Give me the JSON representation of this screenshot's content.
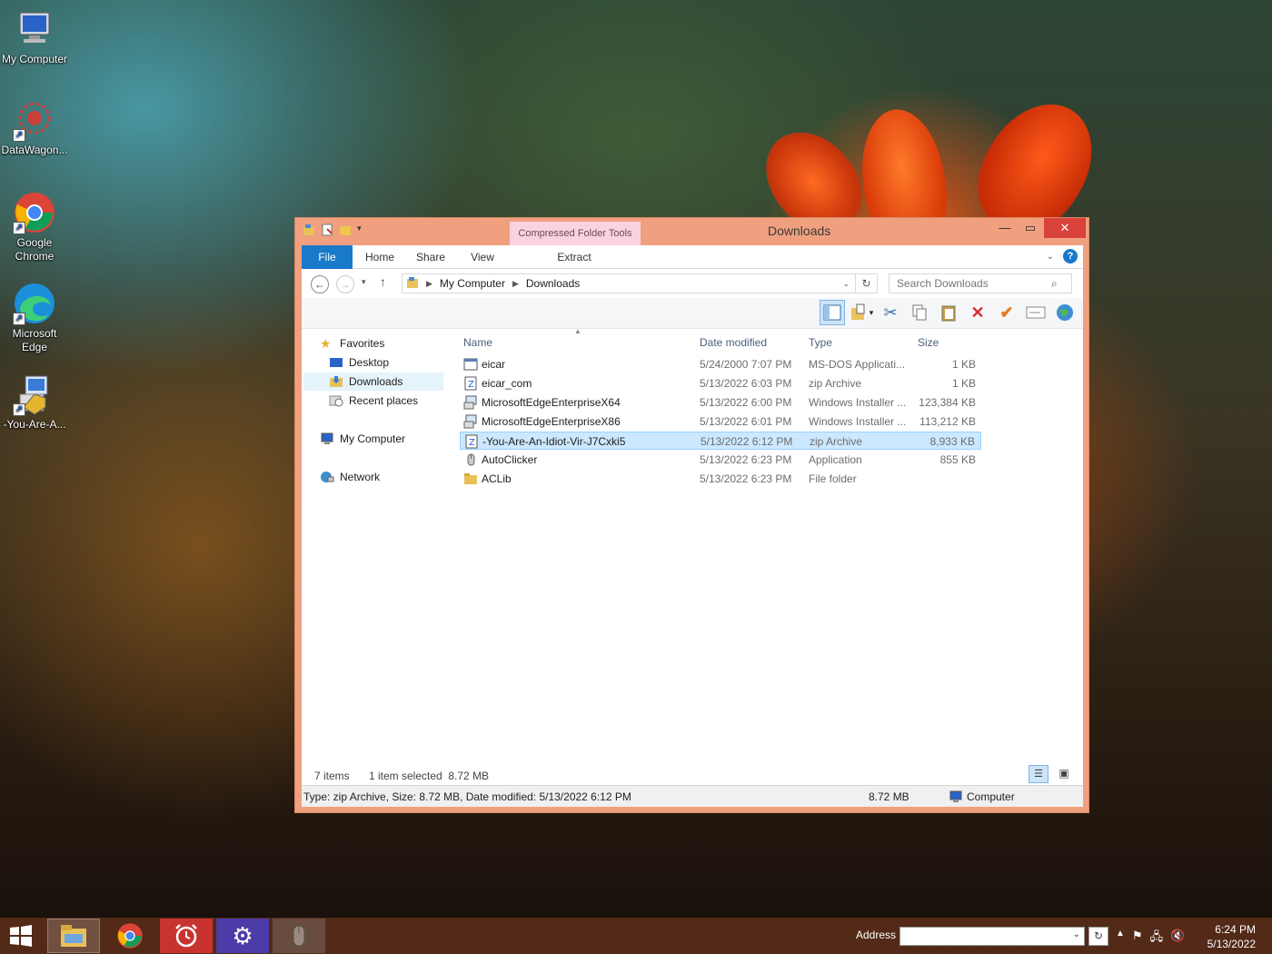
{
  "desktop": {
    "icons": [
      {
        "label": "My Computer",
        "icon": "monitor-icon"
      },
      {
        "label": "DataWagon...",
        "icon": "datawagon-icon"
      },
      {
        "label": "Google Chrome",
        "icon": "chrome-icon"
      },
      {
        "label": "Microsoft Edge",
        "icon": "edge-icon"
      },
      {
        "label": "-You-Are-A...",
        "icon": "installer-icon"
      }
    ]
  },
  "window": {
    "title": "Downloads",
    "context_tab": "Compressed Folder Tools",
    "ribbon_tabs": {
      "file": "File",
      "home": "Home",
      "share": "Share",
      "view": "View",
      "extract": "Extract"
    },
    "address": {
      "root": "My Computer",
      "current": "Downloads"
    },
    "search_placeholder": "Search Downloads",
    "nav": {
      "favorites": "Favorites",
      "desktop": "Desktop",
      "downloads": "Downloads",
      "recent": "Recent places",
      "computer": "My Computer",
      "network": "Network"
    },
    "columns": {
      "name": "Name",
      "date": "Date modified",
      "type": "Type",
      "size": "Size"
    },
    "files": [
      {
        "name": "eicar",
        "date": "5/24/2000 7:07 PM",
        "type": "MS-DOS Applicati...",
        "size": "1 KB",
        "icon": "msdos-icon"
      },
      {
        "name": "eicar_com",
        "date": "5/13/2022 6:03 PM",
        "type": "zip Archive",
        "size": "1 KB",
        "icon": "zip-icon"
      },
      {
        "name": "MicrosoftEdgeEnterpriseX64",
        "date": "5/13/2022 6:00 PM",
        "type": "Windows Installer ...",
        "size": "123,384 KB",
        "icon": "msi-icon"
      },
      {
        "name": "MicrosoftEdgeEnterpriseX86",
        "date": "5/13/2022 6:01 PM",
        "type": "Windows Installer ...",
        "size": "113,212 KB",
        "icon": "msi-icon"
      },
      {
        "name": "-You-Are-An-Idiot-Vir-J7Cxki5",
        "date": "5/13/2022 6:12 PM",
        "type": "zip Archive",
        "size": "8,933 KB",
        "icon": "zip-icon",
        "selected": true
      },
      {
        "name": "AutoClicker",
        "date": "5/13/2022 6:23 PM",
        "type": "Application",
        "size": "855 KB",
        "icon": "mouse-icon"
      },
      {
        "name": "ACLib",
        "date": "5/13/2022 6:23 PM",
        "type": "File folder",
        "size": "",
        "icon": "folder-icon"
      }
    ],
    "status": {
      "items": "7 items",
      "selected": "1 item selected  8.72 MB"
    },
    "details": {
      "info": "Type: zip Archive, Size: 8.72 MB, Date modified: 5/13/2022 6:12 PM",
      "size": "8.72 MB",
      "location": "Computer"
    }
  },
  "taskbar": {
    "address_label": "Address",
    "time": "6:24 PM",
    "date": "5/13/2022"
  },
  "colors": {
    "window_frame": "#f0a07e",
    "accent": "#1979ca",
    "close": "#d9423a",
    "selection": "#cce8ff"
  }
}
